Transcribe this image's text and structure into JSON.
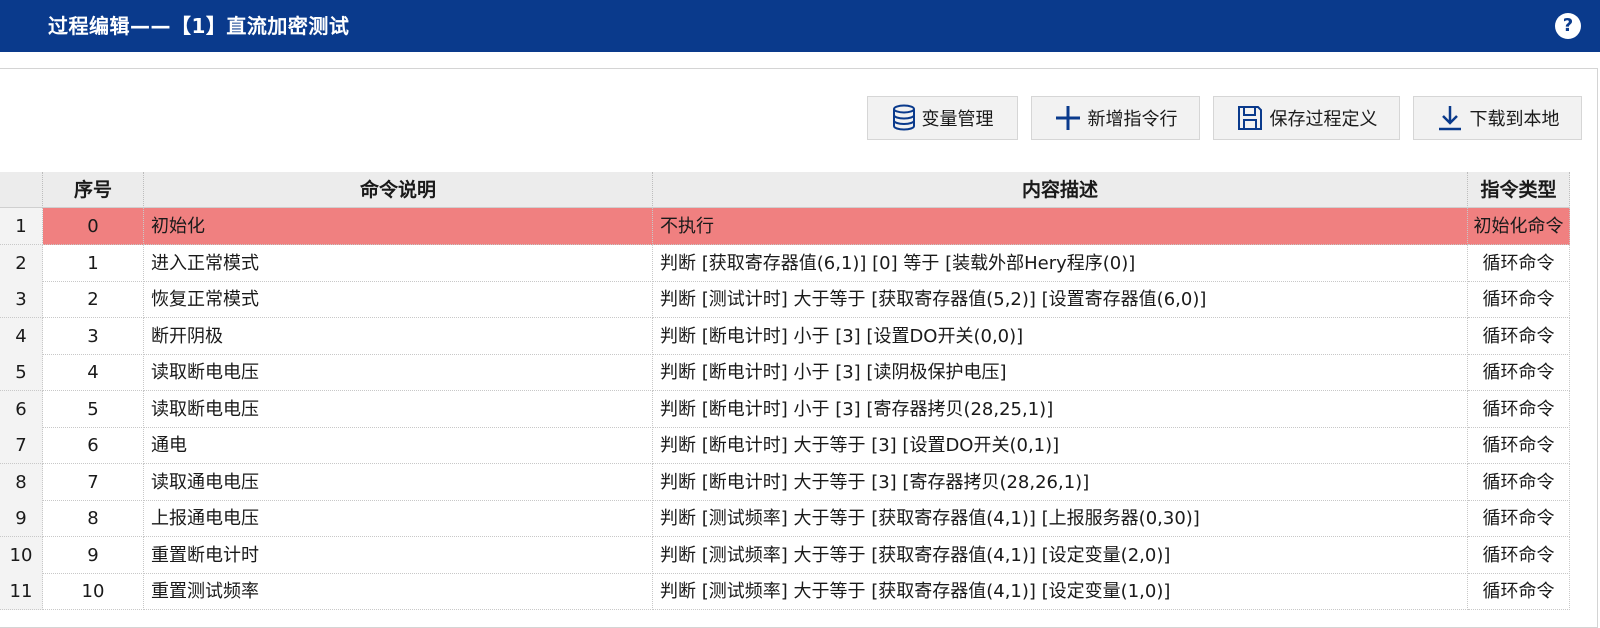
{
  "window": {
    "title": "过程编辑——【1】直流加密测试",
    "help_label": "?"
  },
  "toolbar": {
    "variables_label": "变量管理",
    "add_row_label": "新增指令行",
    "save_label": "保存过程定义",
    "download_label": "下载到本地",
    "icons": {
      "variables": "database-icon",
      "add_row": "plus-icon",
      "save": "floppy-disk-icon",
      "download": "download-icon"
    },
    "icon_color": "#0a3a8c"
  },
  "table": {
    "columns": [
      "",
      "序号",
      "命令说明",
      "内容描述",
      "指令类型"
    ],
    "selected_row_color": "#f08080",
    "rows": [
      {
        "rownum": "1",
        "seq": "0",
        "cmd": "初始化",
        "desc": "不执行",
        "type": "初始化命令",
        "selected": true
      },
      {
        "rownum": "2",
        "seq": "1",
        "cmd": "进入正常模式",
        "desc": "判断 [获取寄存器值(6,1)] [0] 等于 [装载外部Hery程序(0)]",
        "type": "循环命令"
      },
      {
        "rownum": "3",
        "seq": "2",
        "cmd": "恢复正常模式",
        "desc": "判断 [测试计时] 大于等于 [获取寄存器值(5,2)] [设置寄存器值(6,0)]",
        "type": "循环命令"
      },
      {
        "rownum": "4",
        "seq": "3",
        "cmd": "断开阴极",
        "desc": "判断 [断电计时] 小于 [3] [设置DO开关(0,0)]",
        "type": "循环命令"
      },
      {
        "rownum": "5",
        "seq": "4",
        "cmd": "读取断电电压",
        "desc": "判断 [断电计时] 小于 [3] [读阴极保护电压]",
        "type": "循环命令"
      },
      {
        "rownum": "6",
        "seq": "5",
        "cmd": "读取断电电压",
        "desc": "判断 [断电计时] 小于 [3] [寄存器拷贝(28,25,1)]",
        "type": "循环命令"
      },
      {
        "rownum": "7",
        "seq": "6",
        "cmd": "通电",
        "desc": "判断 [断电计时] 大于等于 [3] [设置DO开关(0,1)]",
        "type": "循环命令"
      },
      {
        "rownum": "8",
        "seq": "7",
        "cmd": "读取通电电压",
        "desc": "判断 [断电计时] 大于等于 [3] [寄存器拷贝(28,26,1)]",
        "type": "循环命令"
      },
      {
        "rownum": "9",
        "seq": "8",
        "cmd": "上报通电电压",
        "desc": "判断 [测试频率] 大于等于 [获取寄存器值(4,1)] [上报服务器(0,30)]",
        "type": "循环命令"
      },
      {
        "rownum": "10",
        "seq": "9",
        "cmd": "重置断电计时",
        "desc": "判断 [测试频率] 大于等于 [获取寄存器值(4,1)] [设定变量(2,0)]",
        "type": "循环命令"
      },
      {
        "rownum": "11",
        "seq": "10",
        "cmd": "重置测试频率",
        "desc": "判断 [测试频率] 大于等于 [获取寄存器值(4,1)] [设定变量(1,0)]",
        "type": "循环命令"
      }
    ]
  }
}
